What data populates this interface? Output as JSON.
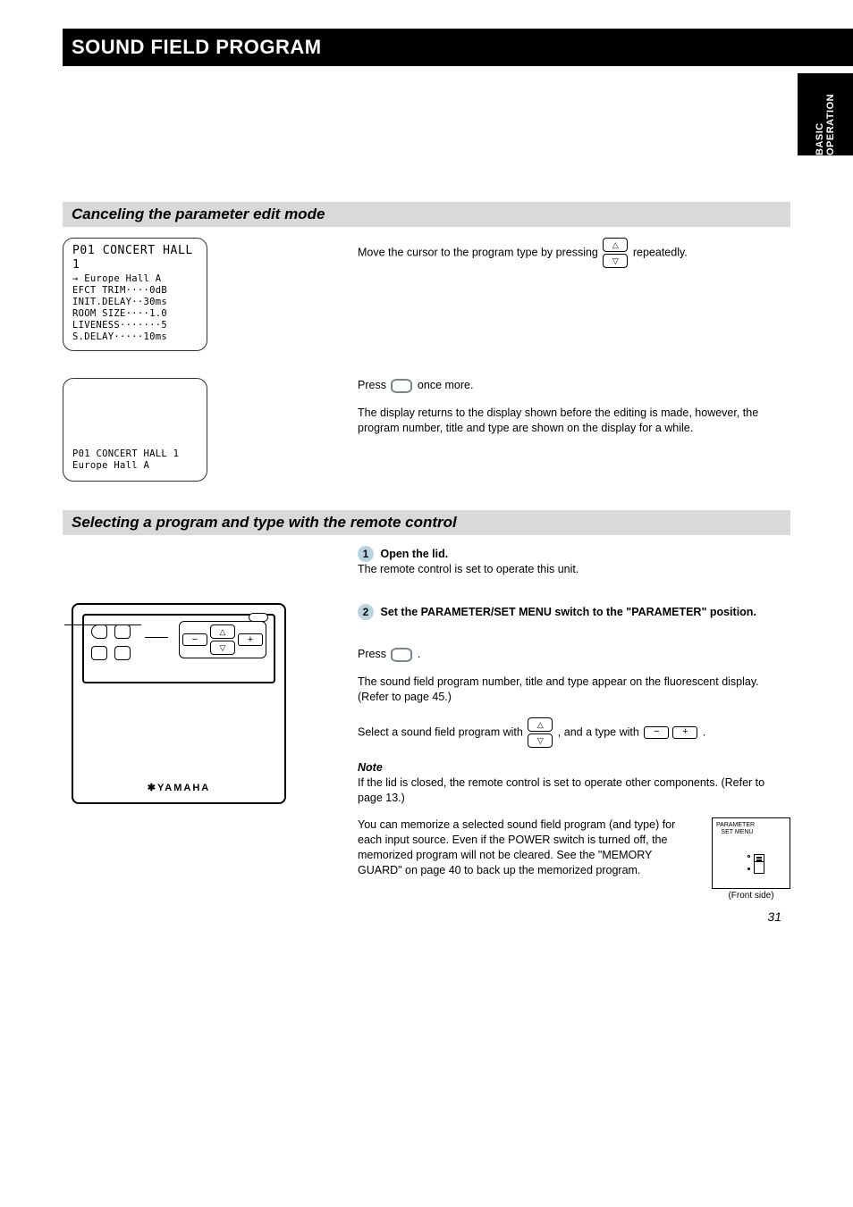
{
  "header": {
    "title": "SOUND FIELD PROGRAM",
    "side_tab": "BASIC OPERATION"
  },
  "sec1": {
    "heading": "Canceling the parameter edit mode",
    "lcd1": {
      "l1": "P01  CONCERT HALL 1",
      "l2": "→  Europe Hall A",
      "l3": "   EFCT TRIM····0dB",
      "l4": "   INIT.DELAY··30ms",
      "l5": "   ROOM SIZE····1.0",
      "l6": "   LIVENESS·······5",
      "l7": "   S.DELAY·····10ms"
    },
    "p1_a": "Move the cursor to the program type by pressing",
    "p1_b": "repeatedly.",
    "lcd2": {
      "l1": "P01  CONCERT HALL 1",
      "l2": "    Europe Hall A"
    },
    "p2_a": "Press",
    "p2_b": "once more.",
    "p3": "The display returns to the display shown before the editing is made, however, the program number, title and type are shown on the display for a while."
  },
  "sec2": {
    "heading": "Selecting a program and type with the remote control",
    "step1_a": "Open the lid.",
    "step1_b": "The remote control is set to operate this unit.",
    "step2": "Set the PARAMETER/SET MENU switch to the \"PARAMETER\" position.",
    "remote_brand": "YAMAHA",
    "p3_a": "Press",
    "p3_b": ".",
    "p4": "The sound field program number, title and type appear on the fluorescent display. (Refer to page 45.)",
    "p5_pre": "Select a sound field program with",
    "p5_post": ", and a type with",
    "p5_end": ".",
    "note_label": "Note",
    "note_body": "If the lid is closed, the remote control is set to operate other components. (Refer to page 13.)",
    "p6": "You can memorize a selected sound field program (and type) for each input source. Even if the POWER switch is turned off, the memorized program will not be cleared. See the \"MEMORY GUARD\" on page 40 to back up the memorized program.",
    "rear": {
      "label": "PARAMETER SET MENU",
      "caption": "(Front side)"
    }
  },
  "page_number": "31"
}
